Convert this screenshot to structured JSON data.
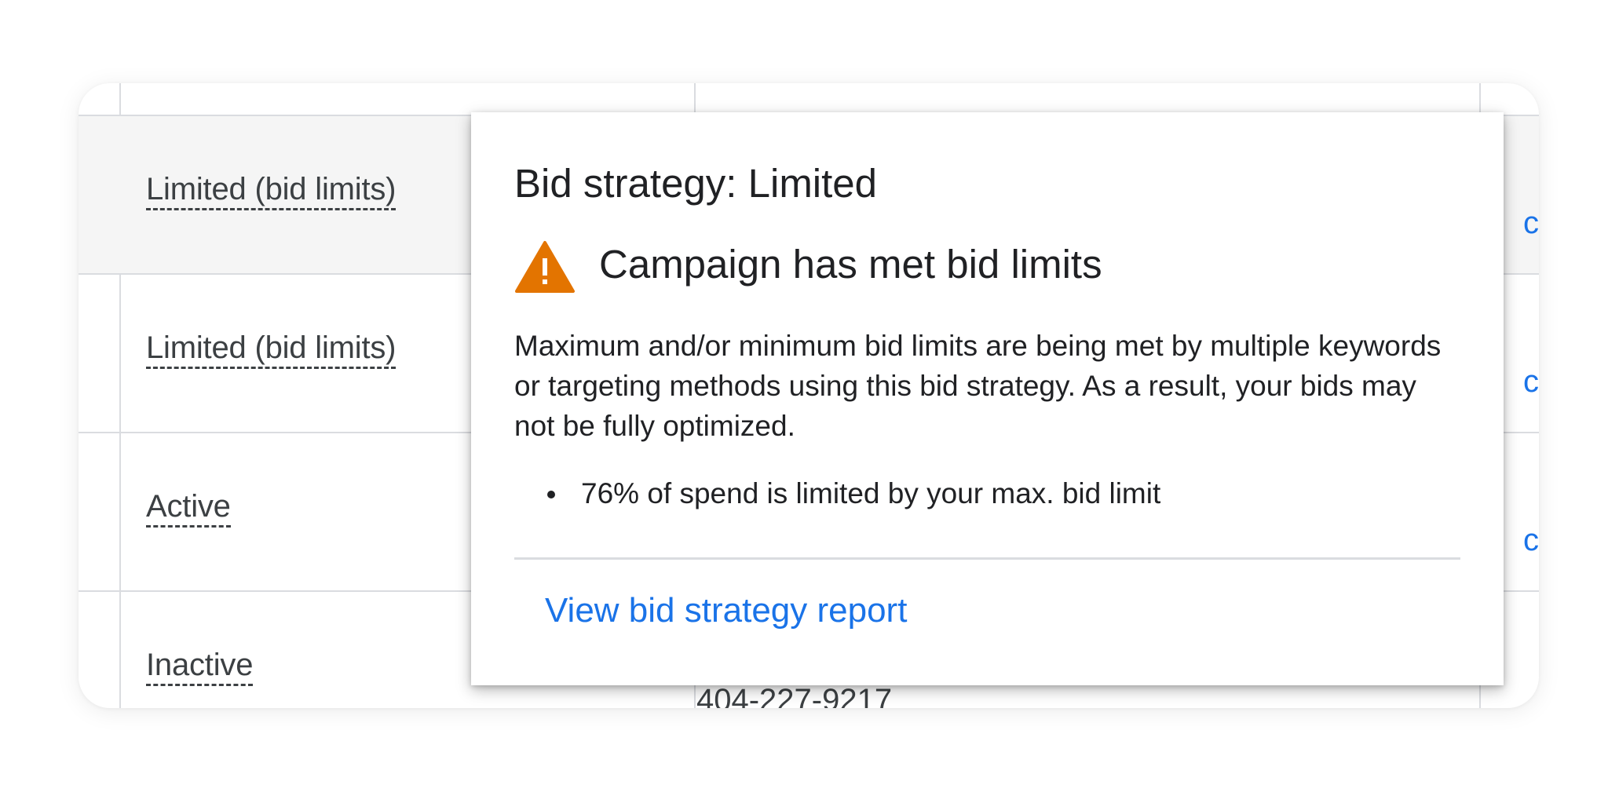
{
  "table": {
    "rows": [
      {
        "status": "Limited (bid limits)",
        "right_fragment": "c"
      },
      {
        "status": "Limited (bid limits)",
        "right_fragment": "c"
      },
      {
        "status": "Active",
        "right_fragment": "c"
      },
      {
        "status": "Inactive",
        "right_fragment": ""
      }
    ],
    "phone_fragment": "404-227-9217"
  },
  "popup": {
    "title": "Bid strategy: Limited",
    "warning_icon": "warning-triangle-icon",
    "warning_color": "#e37400",
    "warning_heading": "Campaign has met bid limits",
    "description": "Maximum and/or minimum bid limits are being met by multiple keywords or targeting methods using this bid strategy. As a result, your bids may not be fully optimized.",
    "bullet": "76% of spend is limited by your max. bid limit",
    "link_label": "View bid strategy report",
    "link_color": "#1a73e8"
  }
}
